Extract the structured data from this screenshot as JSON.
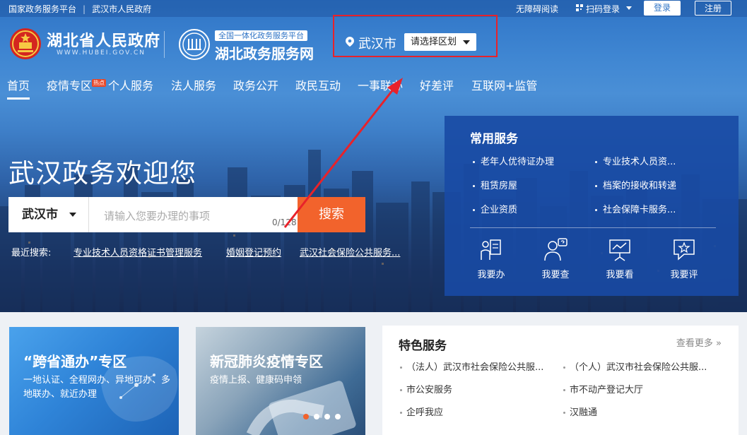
{
  "topbar": {
    "link1": "国家政务服务平台",
    "link2": "武汉市人民政府",
    "accessibility": "无障碍阅读",
    "scan_login": "扫码登录",
    "login": "登录",
    "register": "注册"
  },
  "header": {
    "gov_title": "湖北省人民政府",
    "gov_url": "WWW.HUBEI.GOV.CN",
    "platform_tag": "全国一体化政务服务平台",
    "platform_title": "湖北政务服务网"
  },
  "location": {
    "city": "武汉市",
    "district_select": "请选择区划"
  },
  "nav": {
    "items": [
      "首页",
      "疫情专区",
      "个人服务",
      "法人服务",
      "政务公开",
      "政民互动",
      "一事联办",
      "好差评",
      "互联网+监管"
    ],
    "hot_badge": "热点"
  },
  "hero": {
    "welcome": "武汉政务欢迎您"
  },
  "search": {
    "city": "武汉市",
    "placeholder": "请输入您要办理的事项",
    "count": "0/128",
    "button": "搜索"
  },
  "recent": {
    "label": "最近搜索:",
    "items": [
      "专业技术人员资格证书管理服务",
      "婚姻登记预约",
      "武汉社会保险公共服务..."
    ]
  },
  "common_services": {
    "title": "常用服务",
    "items": [
      "老年人优待证办理",
      "专业技术人员资...",
      "租赁房屋",
      "档案的接收和转递",
      "企业资质",
      "社会保障卡服务..."
    ],
    "actions": [
      "我要办",
      "我要查",
      "我要看",
      "我要评"
    ]
  },
  "cards": [
    {
      "title": "“跨省通办”专区",
      "desc": "一地认证、全程网办、异地可办、多地联办、就近办理"
    },
    {
      "title": "新冠肺炎疫情专区",
      "desc": "疫情上报、健康码申领"
    }
  ],
  "featured": {
    "title": "特色服务",
    "more": "查看更多",
    "items": [
      "（法人）武汉市社会保险公共服...",
      "（个人）武汉市社会保险公共服...",
      "市公安服务",
      "市不动产登记大厅",
      "企呼我应",
      "汉融通"
    ]
  },
  "colors": {
    "accent_orange": "#f2632c",
    "highlight_red": "#e8222a",
    "service_panel": "#184aa4"
  }
}
